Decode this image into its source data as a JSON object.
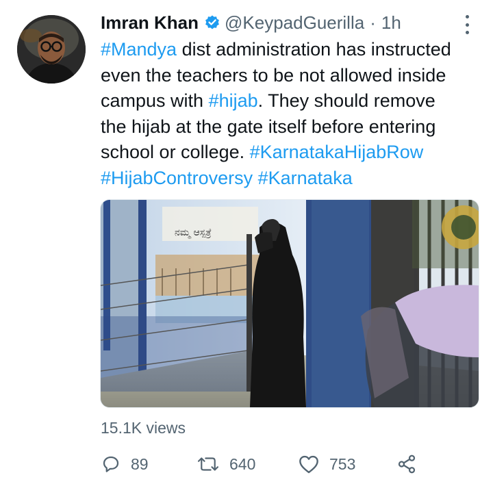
{
  "tweet": {
    "author_name": "Imran Khan",
    "verified_icon": "verified-badge-icon",
    "handle": "@KeypadGuerilla",
    "separator": "·",
    "time": "1h",
    "text_lines": [
      [
        {
          "t": "#Mandya",
          "tag": true
        },
        {
          "t": " dist administration has instructed",
          "tag": false
        }
      ],
      [
        {
          "t": "even the teachers to be not allowed inside",
          "tag": false
        }
      ],
      [
        {
          "t": "campus with ",
          "tag": false
        },
        {
          "t": "#hijab",
          "tag": true
        },
        {
          "t": ". They should remove",
          "tag": false
        }
      ],
      [
        {
          "t": "the hijab at the gate itself before entering",
          "tag": false
        }
      ],
      [
        {
          "t": "school or college. ",
          "tag": false
        },
        {
          "t": "#KarnatakaHijabRow",
          "tag": true
        }
      ],
      [
        {
          "t": "#HijabControversy",
          "tag": true
        },
        {
          "t": " ",
          "tag": false
        },
        {
          "t": "#Karnataka",
          "tag": true
        }
      ]
    ],
    "media_sign_text": "ನಮ್ಮ ಆಸ್ಪತ್ರೆ",
    "views": "15.1K views",
    "actions": {
      "reply": {
        "icon": "reply-icon",
        "count": "89"
      },
      "retweet": {
        "icon": "retweet-icon",
        "count": "640"
      },
      "like": {
        "icon": "heart-icon",
        "count": "753"
      },
      "share": {
        "icon": "share-icon"
      }
    },
    "colors": {
      "link": "#1d9bf0",
      "secondary": "#536471",
      "primary_text": "#0f1419"
    }
  }
}
